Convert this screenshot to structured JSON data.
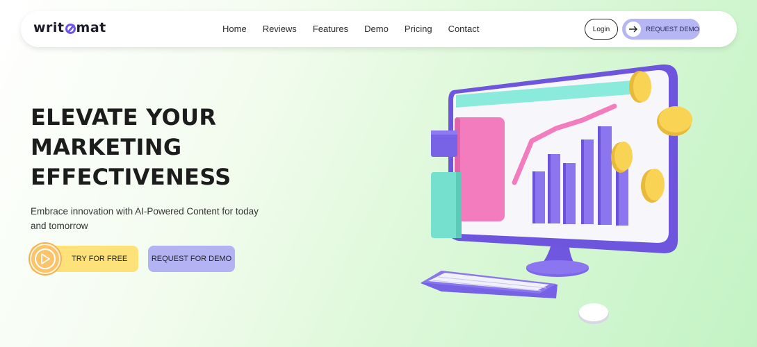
{
  "brand": {
    "logo_text_left": "writ",
    "logo_text_right": "mat"
  },
  "nav": {
    "links": [
      "Home",
      "Reviews",
      "Features",
      "Demo",
      "Pricing",
      "Contact"
    ],
    "login_label": "Login",
    "request_demo_label": "REQUEST DEMO"
  },
  "hero": {
    "title_lines": [
      "ELEVATE YOUR",
      "MARKETING",
      "EFFECTIVENESS"
    ],
    "subtitle": "Embrace innovation with AI-Powered Content for today and tomorrow",
    "try_label": "TRY FOR FREE",
    "demo_label": "REQUEST FOR DEMO"
  },
  "colors": {
    "accent_purple": "#7b68ee",
    "accent_yellow": "#fde27a",
    "accent_lavender": "#b3b3f4",
    "accent_teal": "#86ead8",
    "accent_pink": "#f57fbf"
  },
  "icons": {
    "arrow": "arrow-right-icon",
    "play": "play-icon"
  }
}
